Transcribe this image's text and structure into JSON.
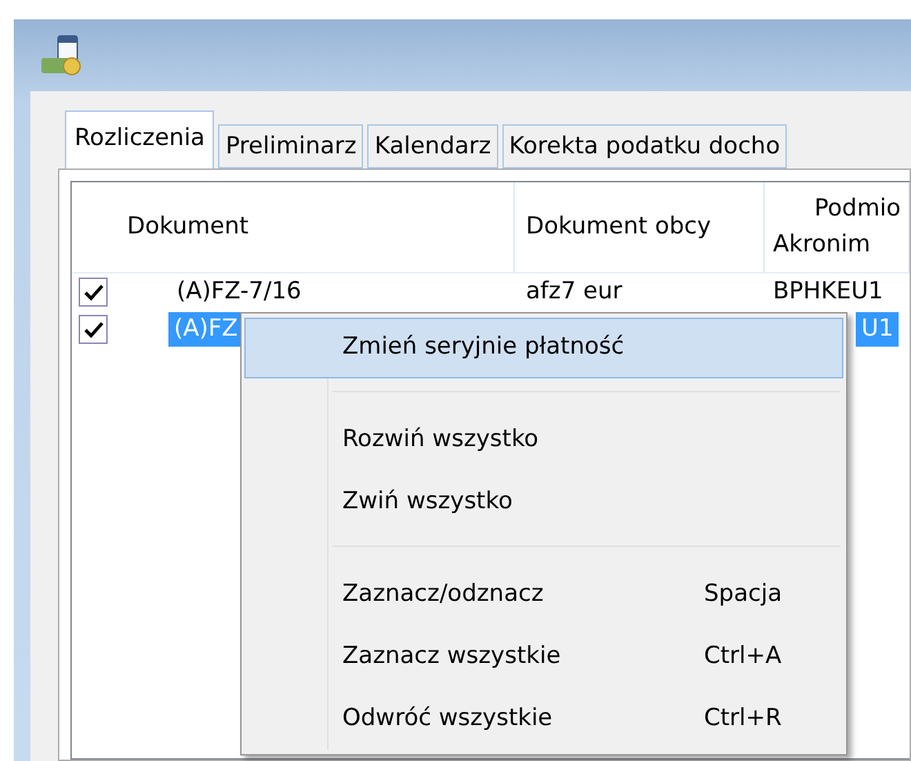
{
  "tabs": [
    {
      "label": "Rozliczenia",
      "selected": true
    },
    {
      "label": "Preliminarz",
      "selected": false
    },
    {
      "label": "Kalendarz",
      "selected": false
    },
    {
      "label": "Korekta podatku docho",
      "selected": false
    }
  ],
  "table": {
    "columns": [
      {
        "label": "Dokument"
      },
      {
        "label": "Dokument obcy"
      },
      {
        "group": "Podmio",
        "label": "Akronim"
      }
    ],
    "rows": [
      {
        "checked": true,
        "selected": false,
        "cells": [
          "(A)FZ-7/16",
          "afz7 eur",
          "BPHKEU1"
        ]
      },
      {
        "checked": true,
        "selected": true,
        "cells": [
          "(A)FZ",
          "",
          "U1"
        ]
      }
    ]
  },
  "context_menu": {
    "items": [
      {
        "kind": "item",
        "label": "Zmień seryjnie płatność",
        "highlighted": true
      },
      {
        "kind": "separator"
      },
      {
        "kind": "item",
        "label": "Rozwiń wszystko",
        "highlighted": false
      },
      {
        "kind": "item",
        "label": "Zwiń wszystko",
        "highlighted": false
      },
      {
        "kind": "separator"
      },
      {
        "kind": "item",
        "label": "Zaznacz/odznacz",
        "shortcut": "Spacja",
        "highlighted": false
      },
      {
        "kind": "item",
        "label": "Zaznacz wszystkie",
        "shortcut": "Ctrl+A",
        "highlighted": false
      },
      {
        "kind": "item",
        "label": "Odwróć wszystkie",
        "shortcut": "Ctrl+R",
        "highlighted": false
      }
    ]
  }
}
